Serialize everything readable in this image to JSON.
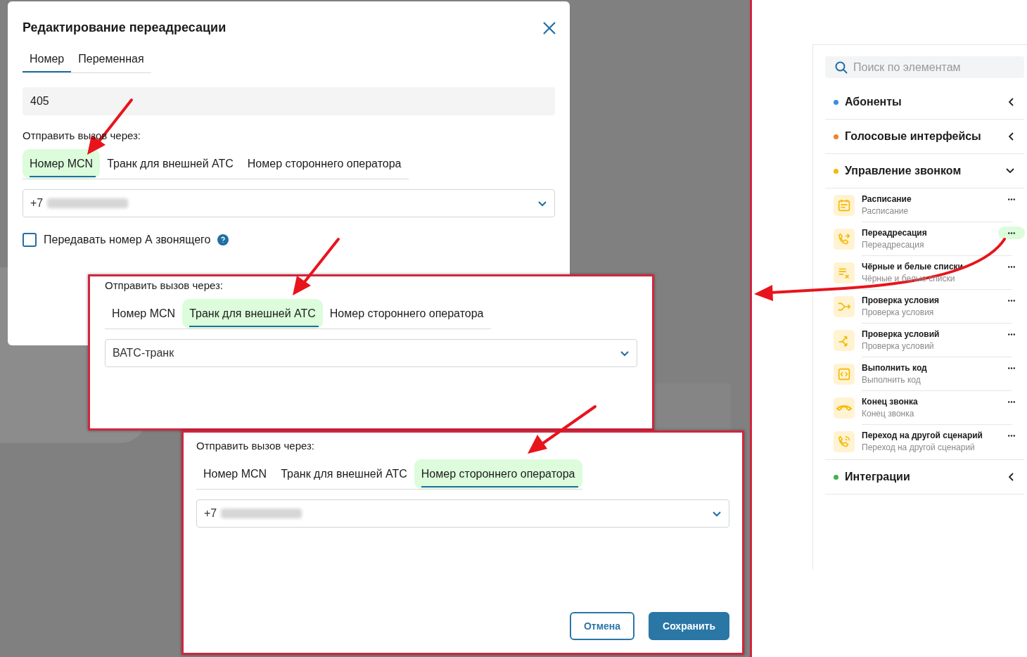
{
  "dialog": {
    "title": "Редактирование переадресации",
    "tabs": [
      {
        "label": "Номер",
        "selected": true
      },
      {
        "label": "Переменная",
        "selected": false
      }
    ],
    "number_value": "405",
    "send_via": {
      "label": "Отправить вызов через:",
      "tabs": [
        {
          "label": "Номер MCN",
          "selected": true
        },
        {
          "label": "Транк для внешней АТС",
          "selected": false
        },
        {
          "label": "Номер стороннего оператора",
          "selected": false
        }
      ],
      "select_value": "+7",
      "redacted": true
    },
    "checkbox": {
      "label": "Передавать номер А звонящего",
      "checked": false
    }
  },
  "insets": [
    {
      "label": "Отправить вызов через:",
      "tabs": [
        {
          "label": "Номер MCN",
          "selected": false
        },
        {
          "label": "Транк для внешней АТС",
          "selected": true
        },
        {
          "label": "Номер стороннего оператора",
          "selected": false
        }
      ],
      "select_value": "ВАТС-транк",
      "redacted": false
    },
    {
      "label": "Отправить вызов через:",
      "tabs": [
        {
          "label": "Номер MCN",
          "selected": false
        },
        {
          "label": "Транк для внешней АТС",
          "selected": false
        },
        {
          "label": "Номер стороннего оператора",
          "selected": true
        }
      ],
      "select_value": "+7",
      "redacted": true,
      "buttons": [
        {
          "label": "Отмена",
          "kind": "secondary"
        },
        {
          "label": "Сохранить",
          "kind": "primary"
        }
      ]
    }
  ],
  "sidebar": {
    "search_placeholder": "Поиск по элементам",
    "groups": [
      {
        "name": "Абоненты",
        "color": "#3b8ee0",
        "expanded": false
      },
      {
        "name": "Голосовые интерфейсы",
        "color": "#f0832e",
        "expanded": false
      },
      {
        "name": "Управление звонком",
        "color": "#f5b800",
        "expanded": true,
        "items": [
          {
            "kind": "schedule",
            "title": "Расписание",
            "subtitle": "Расписание",
            "highlighted": false
          },
          {
            "kind": "redirect",
            "title": "Переадресация",
            "subtitle": "Переадресация",
            "highlighted": true
          },
          {
            "kind": "lists",
            "title": "Чёрные и белые списки",
            "subtitle": "Чёрные и белые списки",
            "highlighted": false
          },
          {
            "kind": "condition",
            "title": "Проверка условия",
            "subtitle": "Проверка условия",
            "highlighted": false
          },
          {
            "kind": "conditions",
            "title": "Проверка условий",
            "subtitle": "Проверка условий",
            "highlighted": false
          },
          {
            "kind": "code",
            "title": "Выполнить код",
            "subtitle": "Выполнить код",
            "highlighted": false
          },
          {
            "kind": "hangup",
            "title": "Конец звонка",
            "subtitle": "Конец звонка",
            "highlighted": false
          },
          {
            "kind": "scenario",
            "title": "Переход на другой сценарий",
            "subtitle": "Переход на другой сценарий",
            "highlighted": false
          }
        ]
      },
      {
        "name": "Интеграции",
        "color": "#3fb34f",
        "expanded": false
      }
    ]
  }
}
